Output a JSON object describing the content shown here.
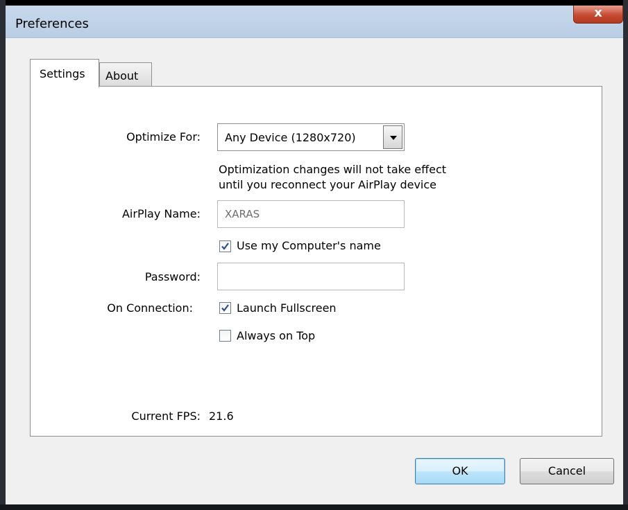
{
  "window": {
    "title": "Preferences",
    "close_label": "x"
  },
  "tabs": [
    {
      "label": "Settings",
      "active": true
    },
    {
      "label": "About",
      "active": false
    }
  ],
  "settings": {
    "optimize_label": "Optimize For:",
    "optimize_value": "Any Device (1280x720)",
    "note_line1": "Optimization changes will not take effect",
    "note_line2": "until you reconnect your AirPlay device",
    "airplay_name_label": "AirPlay Name:",
    "airplay_name_value": "XARAS",
    "use_computer_name_label": "Use my Computer's name",
    "use_computer_name_checked": true,
    "password_label": "Password:",
    "password_value": "",
    "on_connection_label": "On Connection:",
    "launch_fullscreen_label": "Launch Fullscreen",
    "launch_fullscreen_checked": true,
    "always_on_top_label": "Always on Top",
    "always_on_top_checked": false,
    "fps_label": "Current FPS:",
    "fps_value": "21.6"
  },
  "buttons": {
    "ok": "OK",
    "cancel": "Cancel"
  }
}
